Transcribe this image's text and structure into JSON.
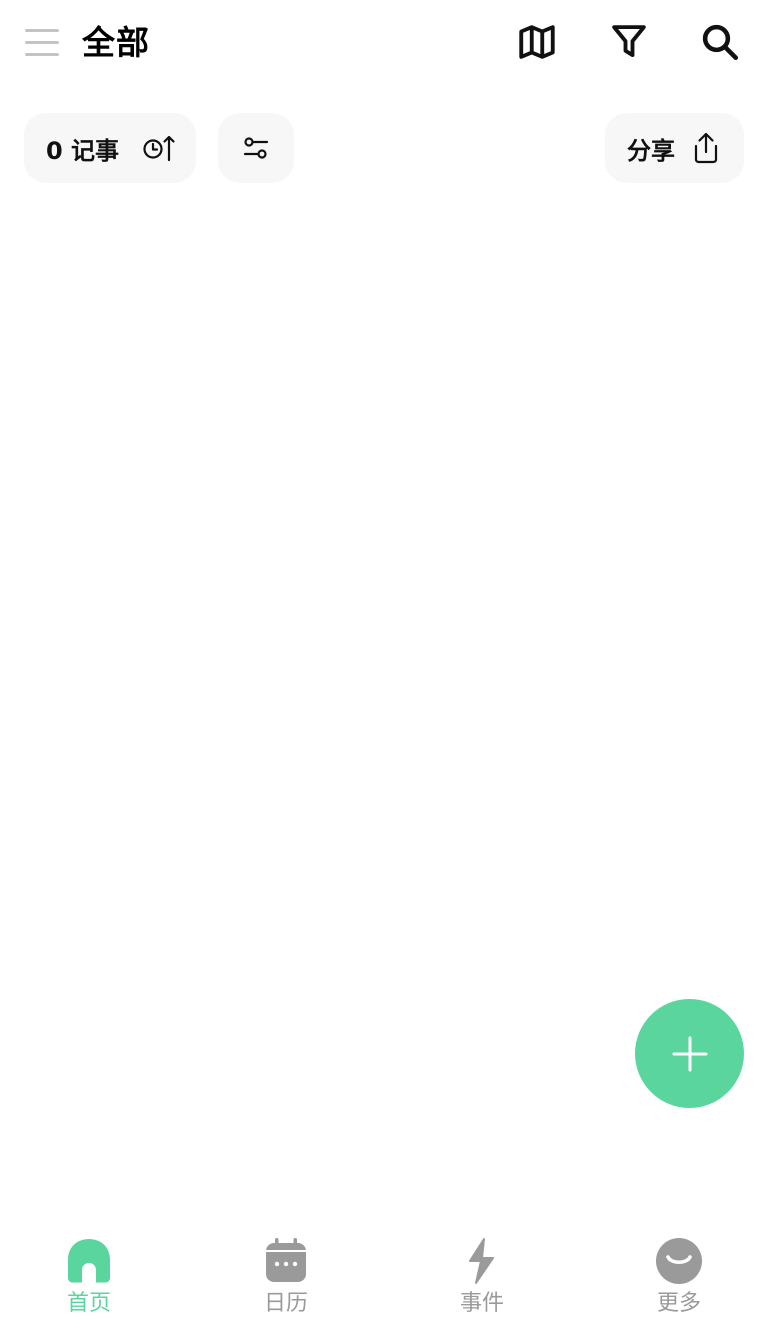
{
  "header": {
    "title": "全部"
  },
  "toolbar": {
    "notes_count_label": "0 记事",
    "share_label": "分享"
  },
  "nav": {
    "items": [
      {
        "label": "首页",
        "icon": "home-icon",
        "active": true
      },
      {
        "label": "日历",
        "icon": "calendar-icon",
        "active": false
      },
      {
        "label": "事件",
        "icon": "lightning-icon",
        "active": false
      },
      {
        "label": "更多",
        "icon": "smile-icon",
        "active": false
      }
    ]
  },
  "colors": {
    "accent": "#5ad59d",
    "inactive": "#9a9a9a",
    "chip_bg": "#f7f7f7",
    "menu_lines": "#c4c4c4"
  }
}
